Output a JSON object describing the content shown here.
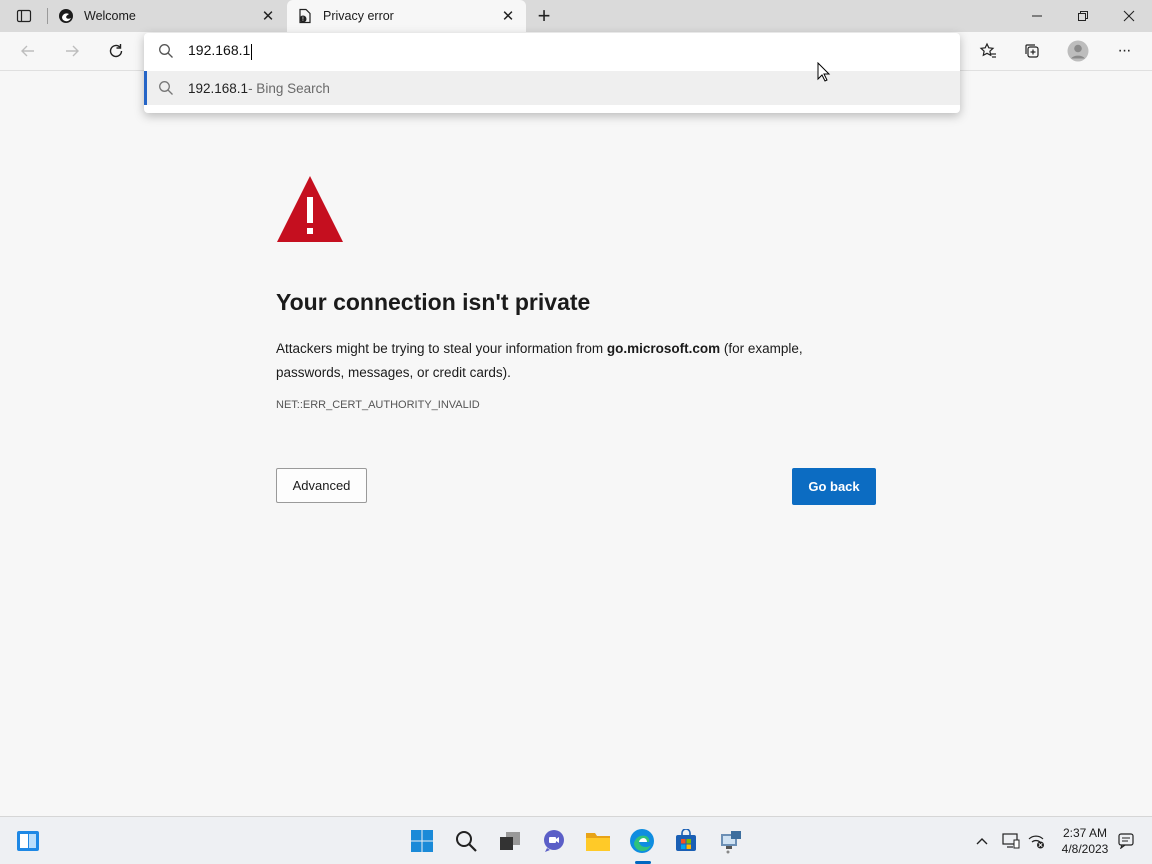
{
  "browser": {
    "tabs": [
      {
        "title": "Welcome",
        "active": false,
        "icon": "edge-icon"
      },
      {
        "title": "Privacy error",
        "active": true,
        "icon": "error-document-icon"
      }
    ],
    "close_glyph": "✕",
    "new_tab_glyph": "+",
    "window_controls": {
      "minimize": "—",
      "restore": "❐",
      "close": "✕"
    }
  },
  "toolbar": {
    "back_icon": "back-arrow-icon",
    "forward_icon": "forward-arrow-icon",
    "refresh_icon": "refresh-icon",
    "favorites_icon": "favorites-icon",
    "collections_icon": "collections-icon",
    "profile_icon": "profile-icon",
    "menu_glyph": "···"
  },
  "omnibox": {
    "value": "192.168.1",
    "suggestion_main": "192.168.1",
    "suggestion_sub": " - Bing Search"
  },
  "error_page": {
    "title": "Your connection isn't private",
    "body_prefix": "Attackers might be trying to steal your information from ",
    "host": "go.microsoft.com",
    "body_suffix": " (for example, passwords, messages, or credit cards).",
    "error_code": "NET::ERR_CERT_AUTHORITY_INVALID",
    "advanced_label": "Advanced",
    "go_back_label": "Go back",
    "colors": {
      "warning_red": "#c50f1f",
      "primary_blue": "#0c6cc2"
    }
  },
  "taskbar": {
    "clock_time": "2:37 AM",
    "clock_date": "4/8/2023",
    "tray_chevron": "^",
    "apps": [
      "widgets-icon",
      "start-icon",
      "search-icon",
      "task-view-icon",
      "chat-icon",
      "file-explorer-icon",
      "edge-icon",
      "store-icon",
      "network-app-icon"
    ]
  }
}
